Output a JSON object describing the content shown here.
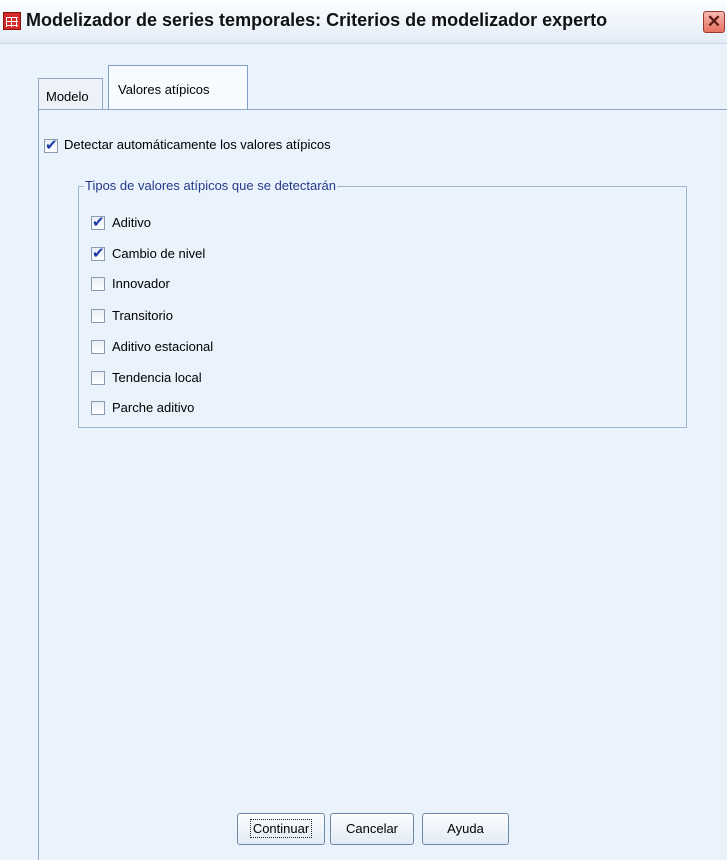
{
  "window": {
    "title": "Modelizador de series temporales: Criterios de modelizador experto",
    "close_symbol": "✕"
  },
  "tabs": [
    {
      "label": "Modelo",
      "selected": false
    },
    {
      "label": "Valores atípicos",
      "selected": true
    }
  ],
  "detect_outliers": {
    "label": "Detectar automáticamente los valores atípicos",
    "checked": true
  },
  "outlier_types": {
    "legend": "Tipos de valores atípicos que se detectarán",
    "items": [
      {
        "label": "Aditivo",
        "checked": true
      },
      {
        "label": "Cambio de nivel",
        "checked": true
      },
      {
        "label": "Innovador",
        "checked": false
      },
      {
        "label": "Transitorio",
        "checked": false
      },
      {
        "label": "Aditivo estacional",
        "checked": false
      },
      {
        "label": "Tendencia local",
        "checked": false
      },
      {
        "label": "Parche aditivo",
        "checked": false
      }
    ]
  },
  "buttons": {
    "continuar": "Continuar",
    "cancelar": "Cancelar",
    "ayuda": "Ayuda"
  },
  "icons": {
    "app": "spss-table-icon",
    "close": "close-icon",
    "check": "checkmark-icon"
  },
  "colors": {
    "background": "#eaf2fb",
    "legend_text": "#243a8c",
    "checkmark": "#1c3aa6"
  }
}
